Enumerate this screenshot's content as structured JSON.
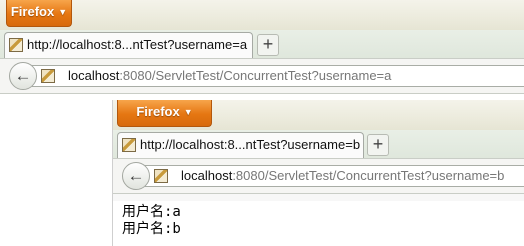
{
  "back_window": {
    "firefox_button": "Firefox",
    "tab_title": "http://localhost:8...ntTest?username=a",
    "new_tab": "+",
    "back": "←",
    "url_host": "localhost",
    "url_rest": ":8080/ServletTest/ConcurrentTest?username=a"
  },
  "front_window": {
    "firefox_button": "Firefox",
    "tab_title": "http://localhost:8...ntTest?username=b",
    "new_tab": "+",
    "back": "←",
    "url_host": "localhost",
    "url_rest": ":8080/ServletTest/ConcurrentTest?username=b",
    "content_lines": [
      "用户名:a",
      "用户名:b"
    ]
  },
  "colors": {
    "firefox_orange": "#e57612",
    "tabstrip": "#dfe7dc"
  }
}
